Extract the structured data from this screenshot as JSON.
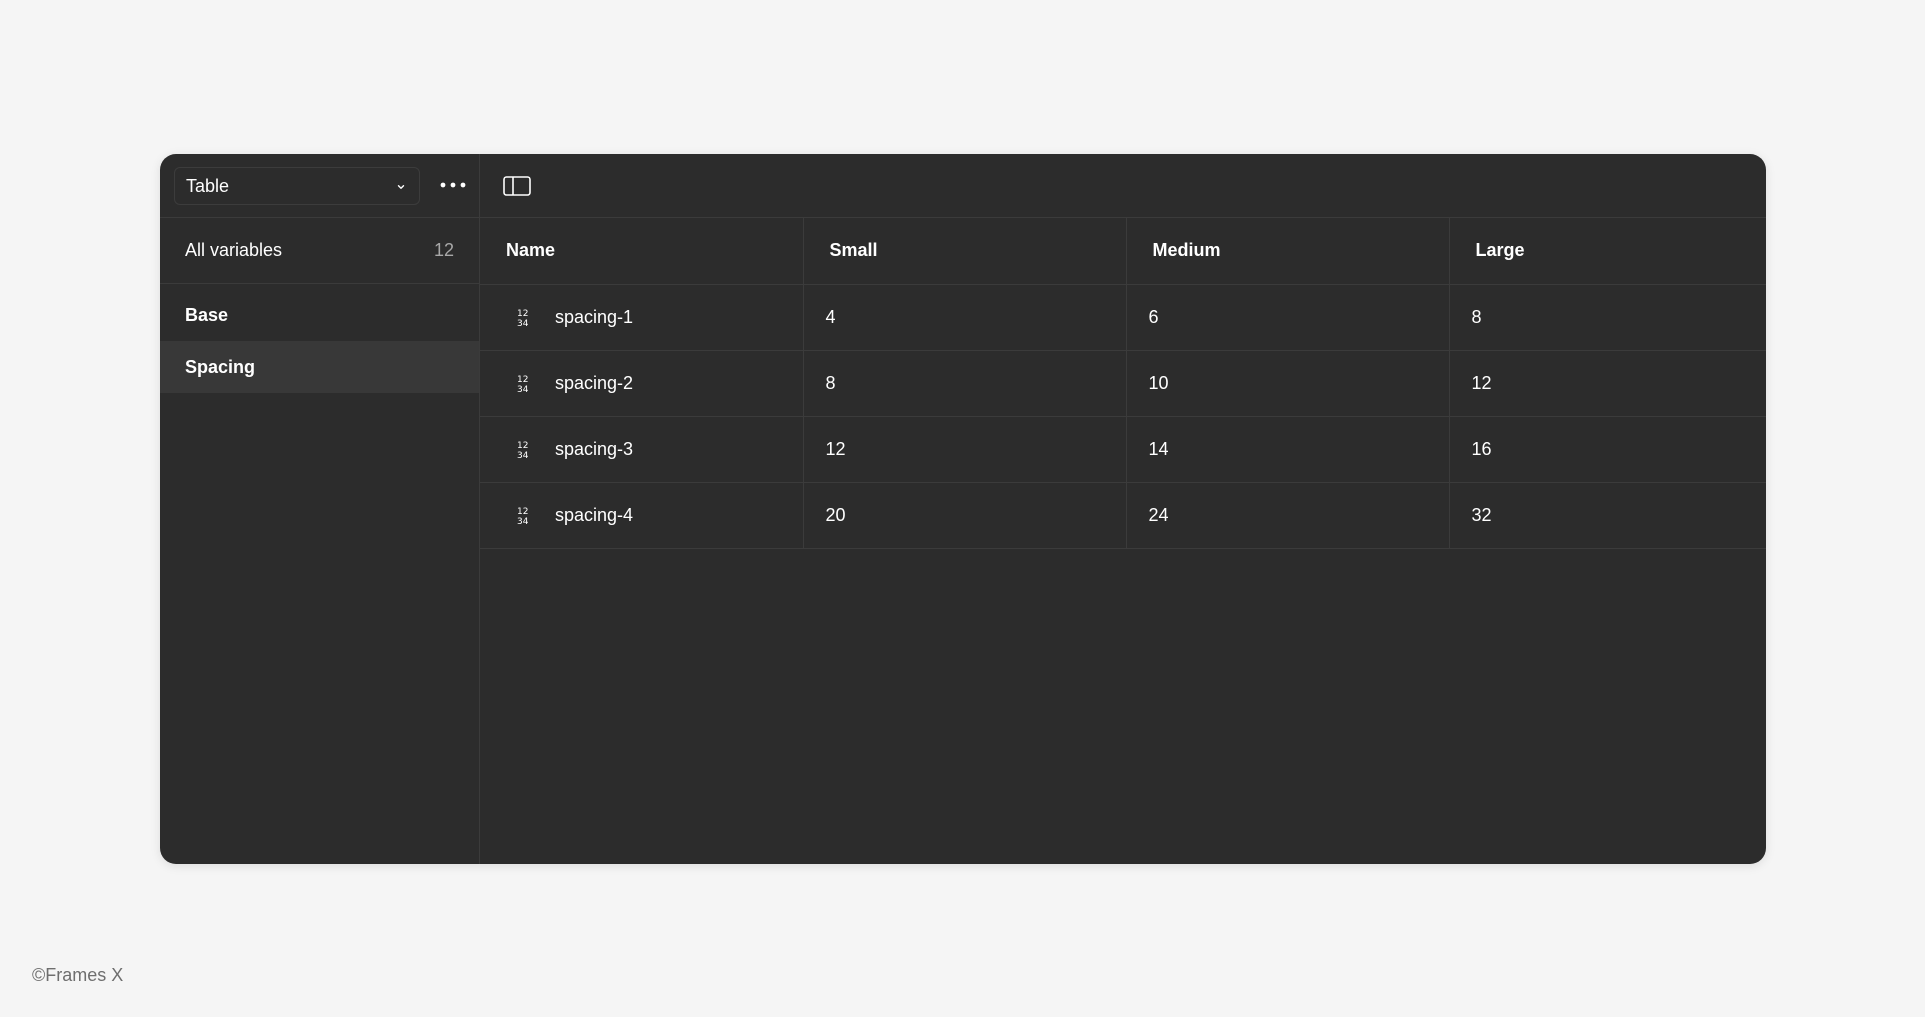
{
  "sidebar": {
    "mode_select": {
      "value": "Table",
      "chevron_icon": "chevron-down-icon"
    },
    "more_icon": "more-horizontal-icon",
    "all_variables": {
      "label": "All variables",
      "count": "12"
    },
    "groups": [
      {
        "label": "Base",
        "active": false
      },
      {
        "label": "Spacing",
        "active": true
      }
    ]
  },
  "toolbar": {
    "sidebar_toggle_icon": "sidebar-toggle-icon"
  },
  "table": {
    "headers": {
      "name": "Name",
      "small": "Small",
      "medium": "Medium",
      "large": "Large"
    },
    "type_icon": "number-type-icon",
    "rows": [
      {
        "name": "spacing-1",
        "small": "4",
        "medium": "6",
        "large": "8"
      },
      {
        "name": "spacing-2",
        "small": "8",
        "medium": "10",
        "large": "12"
      },
      {
        "name": "spacing-3",
        "small": "12",
        "medium": "14",
        "large": "16"
      },
      {
        "name": "spacing-4",
        "small": "20",
        "medium": "24",
        "large": "32"
      }
    ]
  },
  "footer": {
    "credit": "©Frames X"
  },
  "colors": {
    "page_background": "#f5f5f5",
    "panel_background": "#2c2c2c",
    "divider": "#3b3b3b",
    "active_row": "#383838",
    "text_primary": "#ffffff",
    "text_muted": "#a8a8a8"
  }
}
